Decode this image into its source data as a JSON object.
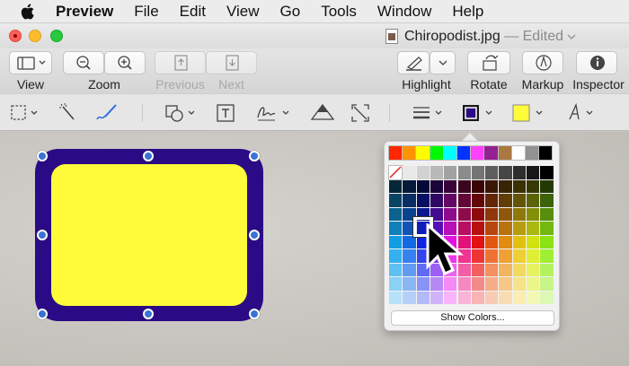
{
  "menubar": {
    "apple_icon": "apple-icon",
    "items": [
      "Preview",
      "File",
      "Edit",
      "View",
      "Go",
      "Tools",
      "Window",
      "Help"
    ]
  },
  "window": {
    "title": "Chiropodist.jpg",
    "edited": "— Edited"
  },
  "toolbar": {
    "view_label": "View",
    "zoom_label": "Zoom",
    "previous_label": "Previous",
    "next_label": "Next",
    "highlight_label": "Highlight",
    "rotate_label": "Rotate",
    "markup_label": "Markup",
    "inspector_label": "Inspector"
  },
  "shape": {
    "border_color": "#2b0a86",
    "fill_color": "#fffb3b",
    "handle_color": "#3a73d6"
  },
  "color_popover": {
    "show_colors_label": "Show Colors...",
    "top_row_colors": [
      "#ff2600",
      "#ff9300",
      "#fffb00",
      "#00f900",
      "#00fdff",
      "#0433ff",
      "#ff40ff",
      "#942192",
      "#aa7942",
      "#ffffff",
      "#929292",
      "#000000"
    ]
  }
}
